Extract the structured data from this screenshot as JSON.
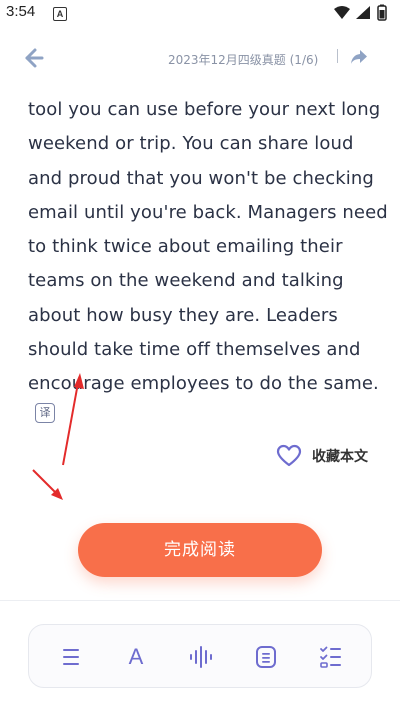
{
  "status_bar": {
    "time": "3:54",
    "notification_letter": "A"
  },
  "nav": {
    "title": "2023年12月四级真题 (1/6)"
  },
  "article": {
    "lines": [
      "tool you can use before your next long",
      "weekend or trip. You can share loud",
      "and proud that you won't be checking",
      "email until you're back. Managers need",
      "to think twice about emailing their",
      "teams on the weekend and talking",
      "about how busy they are. Leaders",
      "should take time off themselves and",
      "encourage employees to do the same."
    ],
    "translate_label": "译"
  },
  "favorite": {
    "label": "收藏本文"
  },
  "finish_button": {
    "label": "完成阅读"
  },
  "toolbar": {
    "font_label": "A",
    "items": [
      "menu-icon",
      "font-icon",
      "audio-waveform-icon",
      "document-icon",
      "checklist-icon"
    ]
  },
  "colors": {
    "accent": "#f86f4a",
    "icon_purple": "#6e6ccf",
    "nav_icon": "#8fa3c4"
  }
}
